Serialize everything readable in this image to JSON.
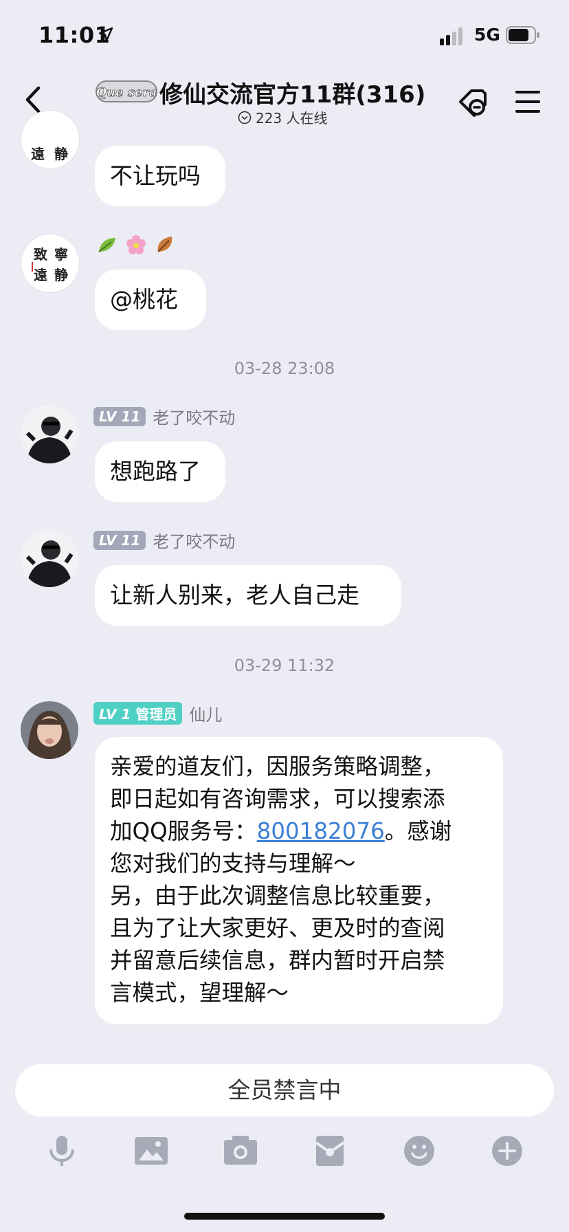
{
  "status_bar": {
    "time": "11:01",
    "network": "5G"
  },
  "header": {
    "title": "修仙交流官方11群(316)",
    "online_text": "223 人在线",
    "brand_logo_text": "Que sera"
  },
  "messages": [
    {
      "avatar_text": [
        "致",
        "寧",
        "遠",
        "静"
      ],
      "text": "不让玩吗"
    },
    {
      "reactions": [
        "leaf",
        "flower",
        "autumn-leaf"
      ],
      "text": "@桃花"
    },
    {
      "timestamp": "03-28 23:08"
    },
    {
      "level": "LV 11",
      "name": "老了咬不动",
      "text": "想跑路了"
    },
    {
      "level": "LV 11",
      "name": "老了咬不动",
      "text": "让新人别来，老人自己走"
    },
    {
      "timestamp": "03-29 11:32"
    },
    {
      "level": "LV 1",
      "role": "管理员",
      "name": "仙儿",
      "lines": [
        "亲爱的道友们，因服务策略调整，",
        "即日起如有咨询需求，可以搜索添",
        "加QQ服务号：",
        "800182076",
        "。感谢",
        "您对我们的支持与理解～",
        "另，由于此次调整信息比较重要，",
        "且为了让大家更好、更及时的查阅",
        "并留意后续信息，群内暂时开启禁",
        "言模式，望理解～"
      ]
    }
  ],
  "bottom": {
    "muted_text": "全员禁言中",
    "tools": [
      "microphone-icon",
      "image-icon",
      "camera-icon",
      "red-packet-icon",
      "emoji-icon",
      "plus-icon"
    ]
  }
}
